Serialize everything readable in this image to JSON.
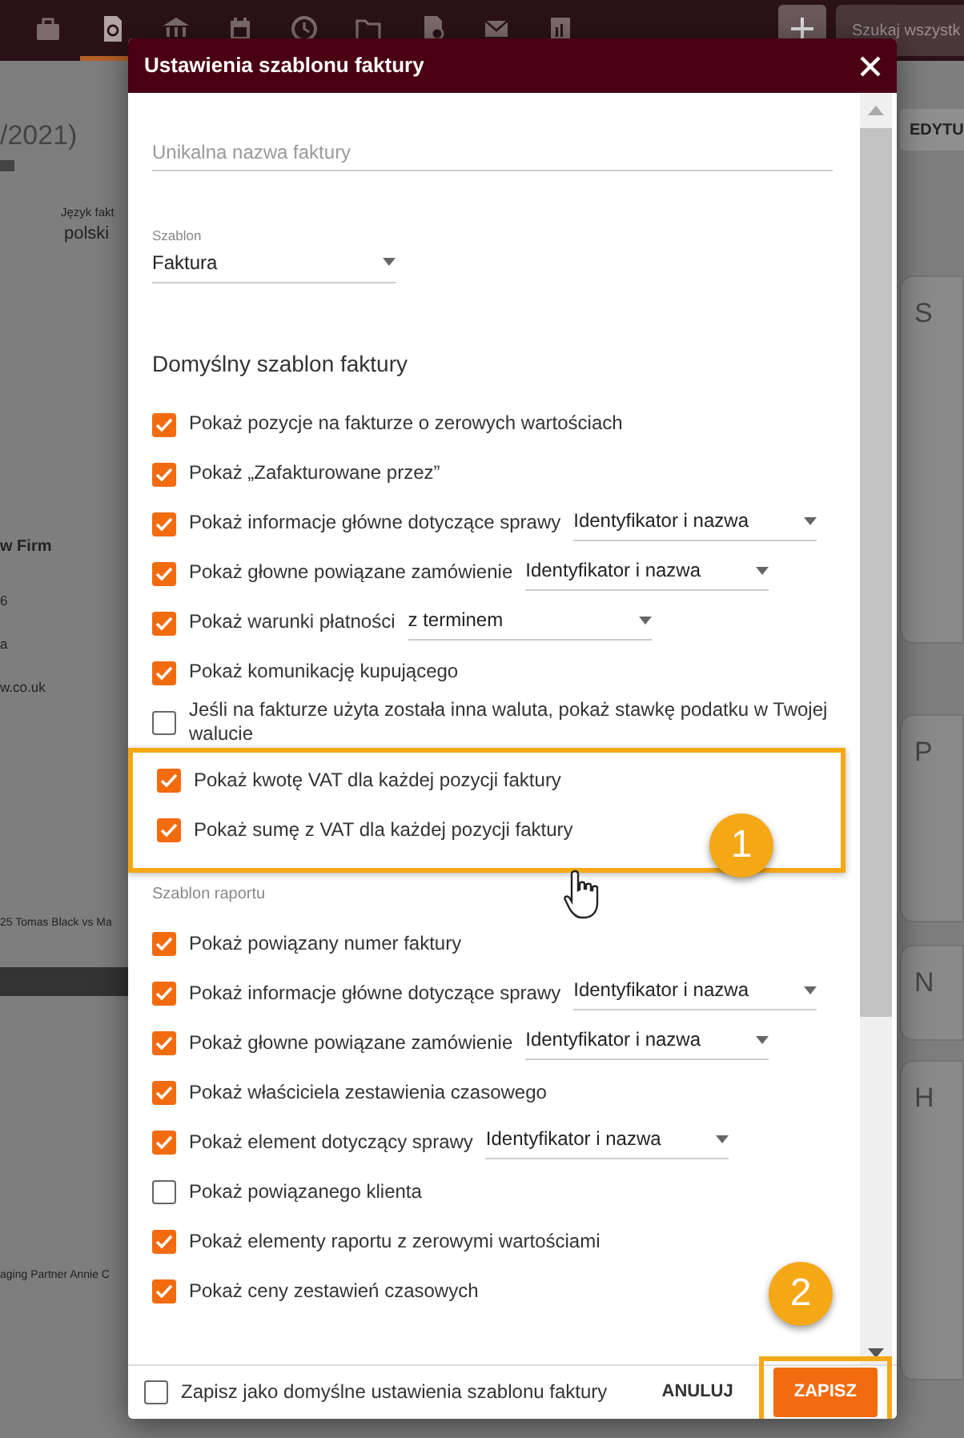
{
  "top_bar": {
    "tabs": [
      {
        "kind": "briefcase",
        "selected": false
      },
      {
        "kind": "invoice",
        "selected": true
      },
      {
        "kind": "bank",
        "selected": false
      },
      {
        "kind": "calendar",
        "selected": false
      },
      {
        "kind": "history",
        "selected": false
      },
      {
        "kind": "folder",
        "selected": false
      },
      {
        "kind": "document",
        "selected": false
      },
      {
        "kind": "mail",
        "selected": false
      },
      {
        "kind": "chart",
        "selected": false
      }
    ],
    "search": {
      "placeholder": "Szukaj wszystk"
    }
  },
  "background": {
    "title_fragment": "/2021)",
    "edit_button": "EDYTU",
    "language_label": "Język fakt",
    "language_value": "polski",
    "firm_fragment": "w Firm",
    "line_1": "6",
    "line_2": "a",
    "line_3": "w.co.uk",
    "matter_fragment": "25  Tomas Black vs Ma",
    "partner_fragment": "aging Partner Annie C",
    "right_cards": [
      "S",
      "P",
      "N",
      "H"
    ]
  },
  "dialog": {
    "title": "Ustawienia szablonu faktury",
    "name_field": {
      "placeholder": "Unikalna nazwa faktury"
    },
    "template_field": {
      "label": "Szablon",
      "value": "Faktura"
    },
    "sections": [
      {
        "kind": "heading",
        "title": "Domyślny szablon faktury",
        "items": [
          {
            "kind": "checkbox",
            "label": "Pokaż pozycje na fakturze o zerowych wartościach",
            "checked": true,
            "highlighted": false
          },
          {
            "kind": "checkbox",
            "label": "Pokaż „Zafakturowane przez”",
            "checked": true,
            "highlighted": false
          },
          {
            "kind": "select",
            "label": "Pokaż informacje główne dotyczące sprawy",
            "value": "Identyfikator i nazwa",
            "checked": true,
            "highlighted": false
          },
          {
            "kind": "select",
            "label": "Pokaż głowne powiązane zamówienie",
            "value": "Identyfikator i nazwa",
            "checked": true,
            "highlighted": false
          },
          {
            "kind": "select",
            "label": "Pokaż warunki płatności",
            "value": "z terminem",
            "checked": true,
            "highlighted": false
          },
          {
            "kind": "checkbox",
            "label": "Pokaż komunikację kupującego",
            "checked": true,
            "highlighted": false
          },
          {
            "kind": "checkbox",
            "label": "Jeśli na fakturze użyta została inna waluta, pokaż stawkę podatku w Twojej walucie",
            "checked": false,
            "highlighted": false
          },
          {
            "kind": "checkbox",
            "label": "Pokaż kwotę VAT dla każdej pozycji faktury",
            "checked": true,
            "highlighted": true
          },
          {
            "kind": "checkbox",
            "label": "Pokaż sumę z VAT dla każdej pozycji faktury",
            "checked": true,
            "highlighted": true
          }
        ]
      },
      {
        "kind": "caption",
        "title": "Szablon raportu",
        "items": [
          {
            "kind": "checkbox",
            "label": "Pokaż powiązany numer faktury",
            "checked": true,
            "highlighted": false
          },
          {
            "kind": "select",
            "label": "Pokaż informacje główne dotyczące sprawy",
            "value": "Identyfikator i nazwa",
            "checked": true,
            "highlighted": false
          },
          {
            "kind": "select",
            "label": "Pokaż głowne powiązane zamówienie",
            "value": "Identyfikator i nazwa",
            "checked": true,
            "highlighted": false
          },
          {
            "kind": "checkbox",
            "label": "Pokaż właściciela zestawienia czasowego",
            "checked": true,
            "highlighted": false
          },
          {
            "kind": "select",
            "label": "Pokaż element dotyczący sprawy",
            "value": "Identyfikator i nazwa",
            "checked": true,
            "highlighted": false
          },
          {
            "kind": "checkbox",
            "label": "Pokaż powiązanego klienta",
            "checked": false,
            "highlighted": false
          },
          {
            "kind": "checkbox",
            "label": "Pokaż elementy raportu z zerowymi wartościami",
            "checked": true,
            "highlighted": false
          },
          {
            "kind": "checkbox",
            "label": "Pokaż ceny zestawień czasowych",
            "checked": true,
            "highlighted": false
          }
        ]
      }
    ],
    "footer": {
      "default_checkbox": {
        "label": "Zapisz jako domyślne ustawienia szablonu faktury",
        "checked": false
      },
      "cancel_button": "ANULUJ",
      "save_button": "ZAPISZ"
    }
  },
  "annotations": [
    {
      "label": "1"
    },
    {
      "label": "2"
    }
  ]
}
